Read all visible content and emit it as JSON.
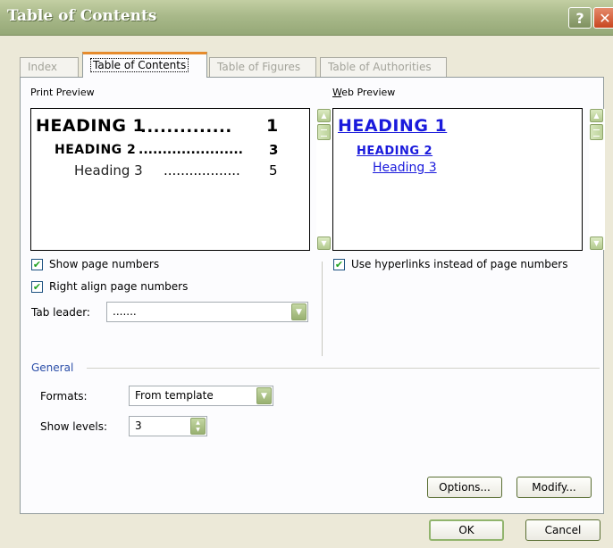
{
  "window": {
    "title": "Table of Contents",
    "help_glyph": "?",
    "close_glyph": "✕"
  },
  "tabs": [
    {
      "label": "Index",
      "active": false
    },
    {
      "label": "Table of Contents",
      "active": true
    },
    {
      "label": "Table of Figures",
      "active": false
    },
    {
      "label": "Table of Authorities",
      "active": false
    }
  ],
  "print_preview": {
    "label": "Print Preview",
    "entries": [
      {
        "text": "HEADING 1",
        "dots": "..............",
        "page": "1"
      },
      {
        "text": "HEADING 2",
        "dots": "......................",
        "page": "3"
      },
      {
        "text": "Heading 3",
        "dots": "..................",
        "page": "5"
      }
    ]
  },
  "web_preview": {
    "label": "Web Preview",
    "entries": [
      "HEADING 1",
      "HEADING 2",
      "Heading 3"
    ]
  },
  "options": {
    "show_page_numbers": {
      "label": "Show page numbers",
      "checked": true
    },
    "right_align": {
      "label": "Right align page numbers",
      "checked": true
    },
    "use_hyperlinks": {
      "label": "Use hyperlinks instead of page numbers",
      "checked": true
    },
    "tab_leader": {
      "label": "Tab leader:",
      "value": "......."
    }
  },
  "general": {
    "label": "General",
    "formats": {
      "label": "Formats:",
      "value": "From template"
    },
    "show_levels": {
      "label": "Show levels:",
      "value": "3"
    }
  },
  "buttons": {
    "options": "Options...",
    "modify": "Modify...",
    "ok": "OK",
    "cancel": "Cancel"
  },
  "colors": {
    "titlebar": "#a9b98a",
    "link": "#1a1adc",
    "active_tab_accent": "#e68b2c",
    "checkmark": "#21a121"
  }
}
